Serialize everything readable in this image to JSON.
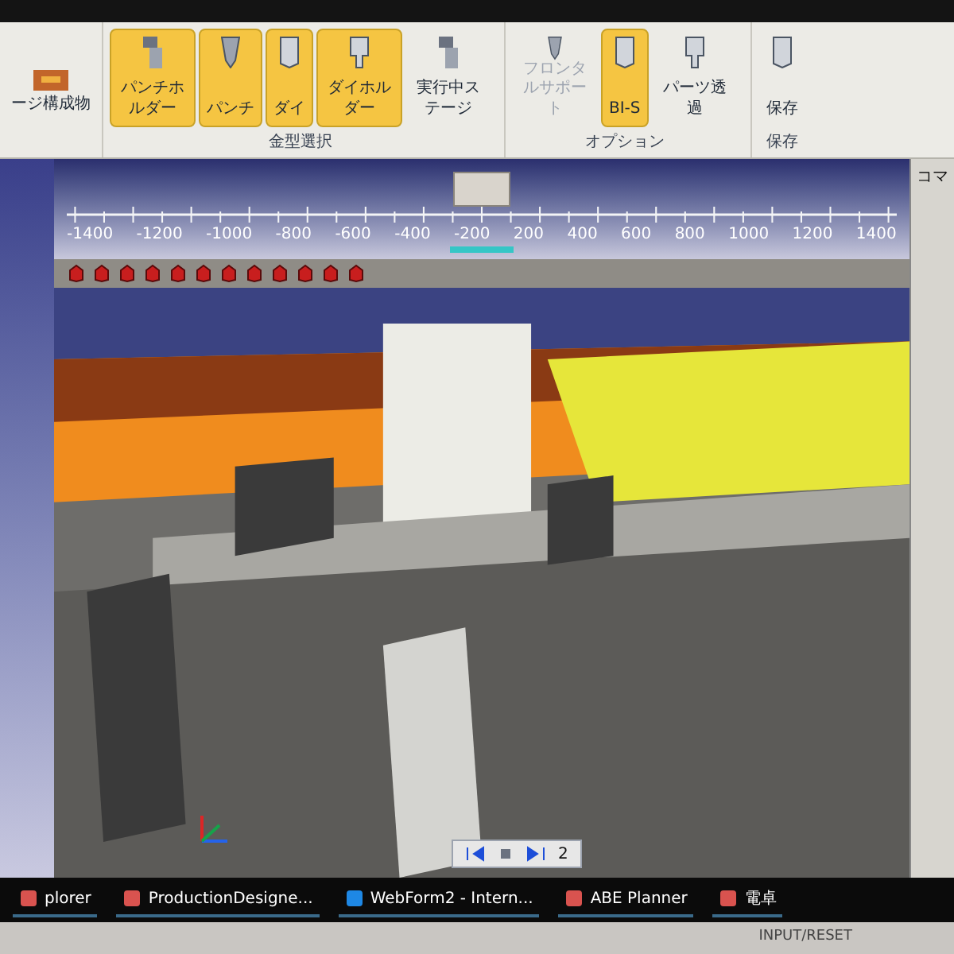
{
  "ribbon": {
    "left_item": {
      "label": "ージ構成物"
    },
    "groups": [
      {
        "label": "金型選択",
        "buttons": [
          {
            "label": "パンチホルダー",
            "selected": true,
            "disabled": false
          },
          {
            "label": "パンチ",
            "selected": true,
            "disabled": false
          },
          {
            "label": "ダイ",
            "selected": true,
            "disabled": false
          },
          {
            "label": "ダイホルダー",
            "selected": true,
            "disabled": false
          },
          {
            "label": "実行中ステージ",
            "selected": false,
            "disabled": false
          }
        ]
      },
      {
        "label": "オプション",
        "buttons": [
          {
            "label": "フロンタルサポート",
            "selected": false,
            "disabled": true
          },
          {
            "label": "BI-S",
            "selected": true,
            "disabled": false
          },
          {
            "label": "パーツ透過",
            "selected": false,
            "disabled": false
          }
        ]
      },
      {
        "label": "保存",
        "buttons": [
          {
            "label": "保存",
            "selected": false,
            "disabled": false
          }
        ]
      }
    ]
  },
  "side_panel": {
    "title": "コマ"
  },
  "ruler": {
    "ticks": [
      "-1400",
      "-1200",
      "-1000",
      "-800",
      "-600",
      "-400",
      "-200",
      "200",
      "400",
      "600",
      "800",
      "1000",
      "1200",
      "1400"
    ]
  },
  "playback": {
    "frame": "2"
  },
  "taskbar": {
    "items": [
      {
        "label": "plorer"
      },
      {
        "label": "ProductionDesigne..."
      },
      {
        "label": "WebForm2 - Intern..."
      },
      {
        "label": "ABE Planner"
      },
      {
        "label": "電卓"
      }
    ]
  },
  "bezel": {
    "button_label": "INPUT/RESET"
  }
}
